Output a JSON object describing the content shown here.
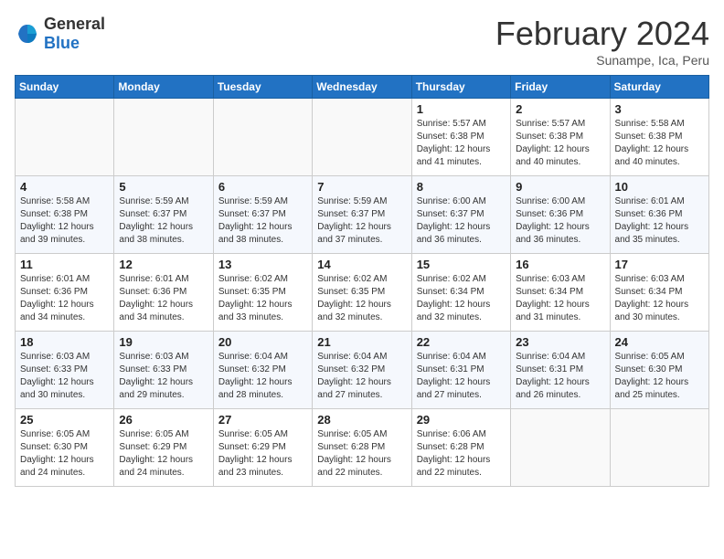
{
  "logo": {
    "general": "General",
    "blue": "Blue"
  },
  "header": {
    "title": "February 2024",
    "subtitle": "Sunampe, Ica, Peru"
  },
  "weekdays": [
    "Sunday",
    "Monday",
    "Tuesday",
    "Wednesday",
    "Thursday",
    "Friday",
    "Saturday"
  ],
  "weeks": [
    [
      {
        "day": "",
        "info": ""
      },
      {
        "day": "",
        "info": ""
      },
      {
        "day": "",
        "info": ""
      },
      {
        "day": "",
        "info": ""
      },
      {
        "day": "1",
        "info": "Sunrise: 5:57 AM\nSunset: 6:38 PM\nDaylight: 12 hours\nand 41 minutes."
      },
      {
        "day": "2",
        "info": "Sunrise: 5:57 AM\nSunset: 6:38 PM\nDaylight: 12 hours\nand 40 minutes."
      },
      {
        "day": "3",
        "info": "Sunrise: 5:58 AM\nSunset: 6:38 PM\nDaylight: 12 hours\nand 40 minutes."
      }
    ],
    [
      {
        "day": "4",
        "info": "Sunrise: 5:58 AM\nSunset: 6:38 PM\nDaylight: 12 hours\nand 39 minutes."
      },
      {
        "day": "5",
        "info": "Sunrise: 5:59 AM\nSunset: 6:37 PM\nDaylight: 12 hours\nand 38 minutes."
      },
      {
        "day": "6",
        "info": "Sunrise: 5:59 AM\nSunset: 6:37 PM\nDaylight: 12 hours\nand 38 minutes."
      },
      {
        "day": "7",
        "info": "Sunrise: 5:59 AM\nSunset: 6:37 PM\nDaylight: 12 hours\nand 37 minutes."
      },
      {
        "day": "8",
        "info": "Sunrise: 6:00 AM\nSunset: 6:37 PM\nDaylight: 12 hours\nand 36 minutes."
      },
      {
        "day": "9",
        "info": "Sunrise: 6:00 AM\nSunset: 6:36 PM\nDaylight: 12 hours\nand 36 minutes."
      },
      {
        "day": "10",
        "info": "Sunrise: 6:01 AM\nSunset: 6:36 PM\nDaylight: 12 hours\nand 35 minutes."
      }
    ],
    [
      {
        "day": "11",
        "info": "Sunrise: 6:01 AM\nSunset: 6:36 PM\nDaylight: 12 hours\nand 34 minutes."
      },
      {
        "day": "12",
        "info": "Sunrise: 6:01 AM\nSunset: 6:36 PM\nDaylight: 12 hours\nand 34 minutes."
      },
      {
        "day": "13",
        "info": "Sunrise: 6:02 AM\nSunset: 6:35 PM\nDaylight: 12 hours\nand 33 minutes."
      },
      {
        "day": "14",
        "info": "Sunrise: 6:02 AM\nSunset: 6:35 PM\nDaylight: 12 hours\nand 32 minutes."
      },
      {
        "day": "15",
        "info": "Sunrise: 6:02 AM\nSunset: 6:34 PM\nDaylight: 12 hours\nand 32 minutes."
      },
      {
        "day": "16",
        "info": "Sunrise: 6:03 AM\nSunset: 6:34 PM\nDaylight: 12 hours\nand 31 minutes."
      },
      {
        "day": "17",
        "info": "Sunrise: 6:03 AM\nSunset: 6:34 PM\nDaylight: 12 hours\nand 30 minutes."
      }
    ],
    [
      {
        "day": "18",
        "info": "Sunrise: 6:03 AM\nSunset: 6:33 PM\nDaylight: 12 hours\nand 30 minutes."
      },
      {
        "day": "19",
        "info": "Sunrise: 6:03 AM\nSunset: 6:33 PM\nDaylight: 12 hours\nand 29 minutes."
      },
      {
        "day": "20",
        "info": "Sunrise: 6:04 AM\nSunset: 6:32 PM\nDaylight: 12 hours\nand 28 minutes."
      },
      {
        "day": "21",
        "info": "Sunrise: 6:04 AM\nSunset: 6:32 PM\nDaylight: 12 hours\nand 27 minutes."
      },
      {
        "day": "22",
        "info": "Sunrise: 6:04 AM\nSunset: 6:31 PM\nDaylight: 12 hours\nand 27 minutes."
      },
      {
        "day": "23",
        "info": "Sunrise: 6:04 AM\nSunset: 6:31 PM\nDaylight: 12 hours\nand 26 minutes."
      },
      {
        "day": "24",
        "info": "Sunrise: 6:05 AM\nSunset: 6:30 PM\nDaylight: 12 hours\nand 25 minutes."
      }
    ],
    [
      {
        "day": "25",
        "info": "Sunrise: 6:05 AM\nSunset: 6:30 PM\nDaylight: 12 hours\nand 24 minutes."
      },
      {
        "day": "26",
        "info": "Sunrise: 6:05 AM\nSunset: 6:29 PM\nDaylight: 12 hours\nand 24 minutes."
      },
      {
        "day": "27",
        "info": "Sunrise: 6:05 AM\nSunset: 6:29 PM\nDaylight: 12 hours\nand 23 minutes."
      },
      {
        "day": "28",
        "info": "Sunrise: 6:05 AM\nSunset: 6:28 PM\nDaylight: 12 hours\nand 22 minutes."
      },
      {
        "day": "29",
        "info": "Sunrise: 6:06 AM\nSunset: 6:28 PM\nDaylight: 12 hours\nand 22 minutes."
      },
      {
        "day": "",
        "info": ""
      },
      {
        "day": "",
        "info": ""
      }
    ]
  ]
}
